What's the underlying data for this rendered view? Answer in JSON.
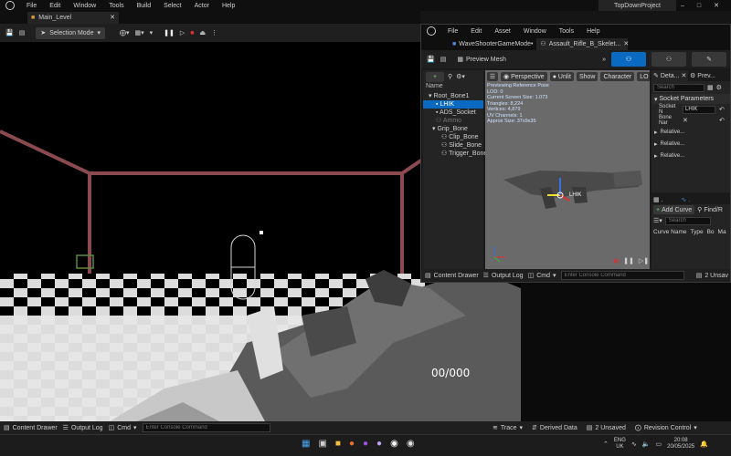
{
  "menu": [
    "File",
    "Edit",
    "Window",
    "Tools",
    "Build",
    "Select",
    "Actor",
    "Help"
  ],
  "project_title": "TopDownProject",
  "level_tab": "Main_Level",
  "main_toolbar": {
    "mode": "Selection Mode"
  },
  "hud": {
    "ammo": "00/000"
  },
  "bottom": {
    "content_drawer": "Content Drawer",
    "output_log": "Output Log",
    "cmd": "Cmd",
    "console_placeholder": "Enter Console Command",
    "trace": "Trace",
    "derived_data": "Derived Data",
    "unsaved": "2 Unsaved",
    "revision_control": "Revision Control"
  },
  "subwindow": {
    "menu": [
      "File",
      "Edit",
      "Asset",
      "Window",
      "Tools",
      "Help"
    ],
    "tabs": [
      "WaveShooterGameMode•",
      "Assault_Rifle_B_Skelet..."
    ],
    "preview_mesh": "Preview Mesh",
    "tree_header": "Name",
    "tree": [
      {
        "label": "Root_Bone1",
        "indent": 0
      },
      {
        "label": "LHIK",
        "indent": 1,
        "selected": true
      },
      {
        "label": "ADS_Socket",
        "indent": 1
      },
      {
        "label": "Ammo",
        "indent": 1,
        "dim": true
      },
      {
        "label": "Grip_Bone",
        "indent": 1
      },
      {
        "label": "Clip_Bone",
        "indent": 2
      },
      {
        "label": "Slide_Bone",
        "indent": 2
      },
      {
        "label": "Trigger_Bone",
        "indent": 2
      }
    ],
    "viewport_buttons": [
      "Perspective",
      "Unlit",
      "Show",
      "Character",
      "LO"
    ],
    "info": [
      "Previewing Reference Pose",
      "LOD: 0",
      "Current Screen Size: 1.073",
      "Triangles: 8,224",
      "Vertices: 4,879",
      "UV Channels: 1",
      "Approx Size: 37x9x35"
    ],
    "socket_label": "LHIK",
    "details": {
      "tab": "Deta...",
      "tab2": "Prev...",
      "search": "Search",
      "section": "Socket Parameters",
      "socket_name_label": "Socket N",
      "socket_name_value": "LHIK",
      "bone_name_label": "Bone Nar",
      "relative1": "Relative...",
      "relative2": "Relative...",
      "relative3": "Relative..."
    },
    "curves": {
      "add_curve": "Add Curve",
      "find": "Find/R",
      "search": "Search",
      "col_name": "Curve Name",
      "col_type": "Type",
      "col_bo": "Bo",
      "col_ma": "Ma"
    },
    "bottom": {
      "content_drawer": "Content Drawer",
      "output_log": "Output Log",
      "cmd": "Cmd",
      "console_placeholder": "Enter Console Command",
      "unsaved": "2 Unsav"
    }
  },
  "taskbar": {
    "lang": "ENG",
    "region": "UK",
    "time": "20:08",
    "date": "20/05/2025"
  }
}
